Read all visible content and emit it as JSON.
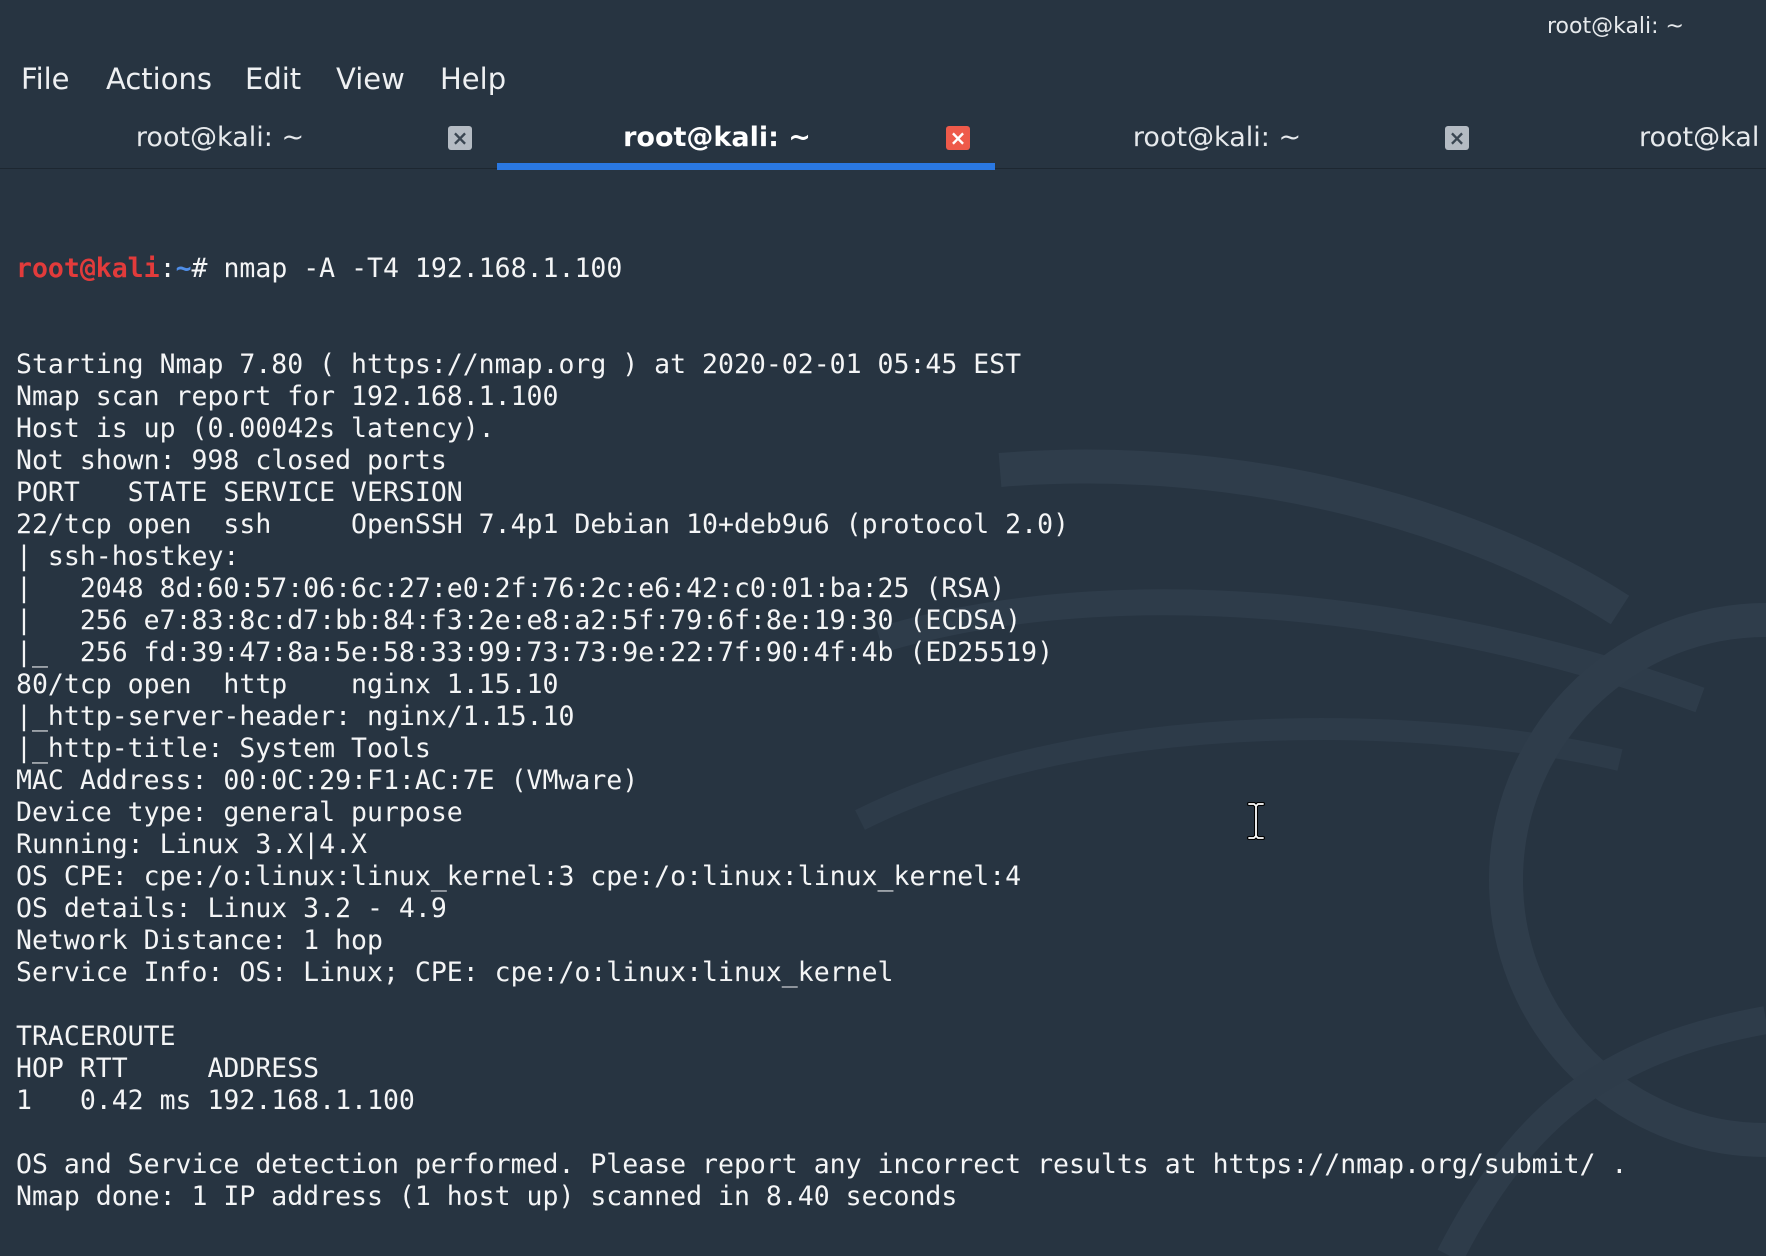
{
  "window": {
    "title": "root@kali: ~"
  },
  "menu": {
    "items": [
      "File",
      "Actions",
      "Edit",
      "View",
      "Help"
    ]
  },
  "tabs": [
    {
      "label": "root@kali: ~",
      "active": false,
      "close_icon": "close-icon"
    },
    {
      "label": "root@kali: ~",
      "active": true,
      "close_icon": "close-icon"
    },
    {
      "label": "root@kali: ~",
      "active": false,
      "close_icon": "close-icon"
    },
    {
      "label": "root@kal",
      "active": false,
      "close_icon": ""
    }
  ],
  "prompt": {
    "user": "root@kali",
    "sep": ":",
    "dir": "~",
    "symbol": "# "
  },
  "terminal": {
    "command": "nmap -A -T4 192.168.1.100",
    "lines": [
      "Starting Nmap 7.80 ( https://nmap.org ) at 2020-02-01 05:45 EST",
      "Nmap scan report for 192.168.1.100",
      "Host is up (0.00042s latency).",
      "Not shown: 998 closed ports",
      "PORT   STATE SERVICE VERSION",
      "22/tcp open  ssh     OpenSSH 7.4p1 Debian 10+deb9u6 (protocol 2.0)",
      "| ssh-hostkey:",
      "|   2048 8d:60:57:06:6c:27:e0:2f:76:2c:e6:42:c0:01:ba:25 (RSA)",
      "|   256 e7:83:8c:d7:bb:84:f3:2e:e8:a2:5f:79:6f:8e:19:30 (ECDSA)",
      "|_  256 fd:39:47:8a:5e:58:33:99:73:73:9e:22:7f:90:4f:4b (ED25519)",
      "80/tcp open  http    nginx 1.15.10",
      "|_http-server-header: nginx/1.15.10",
      "|_http-title: System Tools",
      "MAC Address: 00:0C:29:F1:AC:7E (VMware)",
      "Device type: general purpose",
      "Running: Linux 3.X|4.X",
      "OS CPE: cpe:/o:linux:linux_kernel:3 cpe:/o:linux:linux_kernel:4",
      "OS details: Linux 3.2 - 4.9",
      "Network Distance: 1 hop",
      "Service Info: OS: Linux; CPE: cpe:/o:linux:linux_kernel",
      "",
      "TRACEROUTE",
      "HOP RTT     ADDRESS",
      "1   0.42 ms 192.168.1.100",
      "",
      "OS and Service detection performed. Please report any incorrect results at https://nmap.org/submit/ .",
      "Nmap done: 1 IP address (1 host up) scanned in 8.40 seconds"
    ]
  },
  "colors": {
    "background": "#273441",
    "prompt_user": "#e23b3b",
    "prompt_dir": "#4f8ee8",
    "active_tab_underline": "#2a78e2",
    "active_close": "#ee5a4a",
    "text": "#f4f5f6"
  },
  "icons": {
    "cursor": "text-cursor-icon",
    "tab_close": "close-icon"
  }
}
